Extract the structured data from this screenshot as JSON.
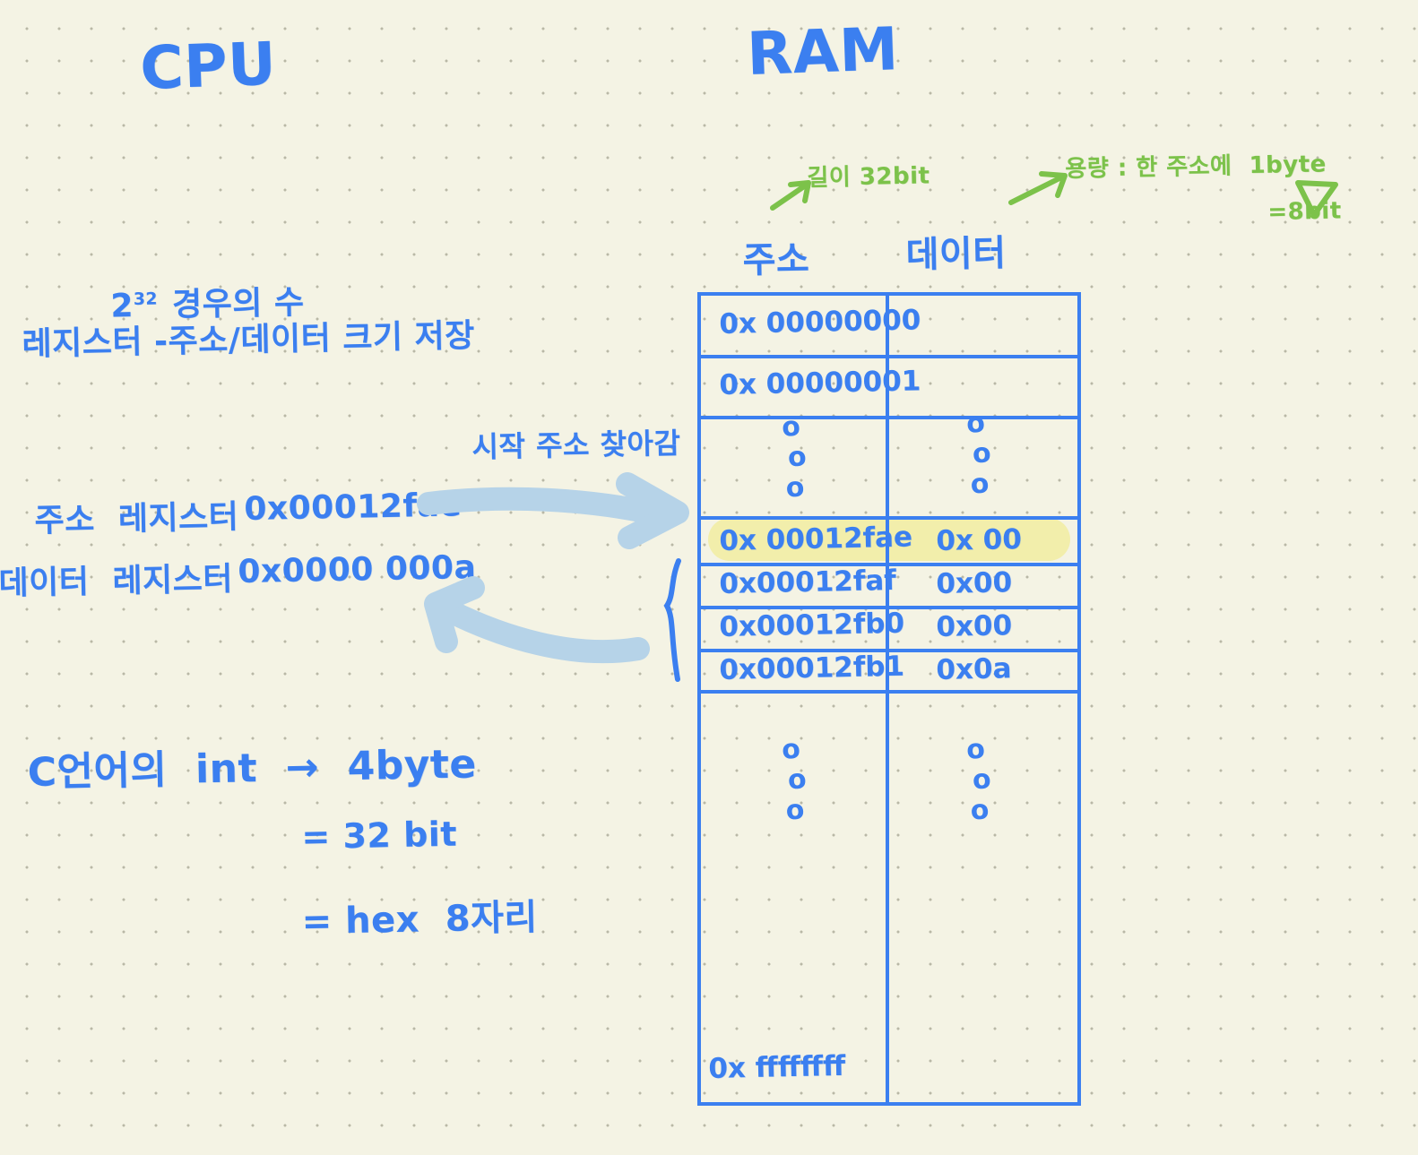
{
  "headings": {
    "cpu": "CPU",
    "ram": "RAM"
  },
  "cpu_notes": {
    "power_base": "2",
    "power_exp": "32",
    "power_label": "경우의 수",
    "register_note": "레지스터 -주소/데이터 크기 저장",
    "address_register_label": "주소  레지스터",
    "address_register_value": "0x00012fae",
    "data_register_label": "데이터  레지스터",
    "data_register_value": "0x0000 000a"
  },
  "c_notes": {
    "line1": "C언어의  int  →  4byte",
    "line2": "= 32 bit",
    "line3": "= hex  8자리"
  },
  "annotations": {
    "seek_start_address": "시작 주소 찾아감",
    "length_32bit": "길이 32bit",
    "capacity_line1": "용량 : 한 주소에  1byte",
    "capacity_line2": "=8bit"
  },
  "ram_table": {
    "col_headers": [
      "주소",
      "데이터"
    ],
    "rows": [
      {
        "address": "0x 00000000",
        "data": "",
        "type": "normal"
      },
      {
        "address": "0x 00000001",
        "data": "",
        "type": "normal"
      },
      {
        "address": "⋮",
        "data": "⋮",
        "type": "ellipsis"
      },
      {
        "address": "0x 00012fae",
        "data": "0x 00",
        "type": "highlight"
      },
      {
        "address": "0x00012faf",
        "data": "0x00",
        "type": "normal"
      },
      {
        "address": "0x00012fb0",
        "data": "0x00",
        "type": "normal"
      },
      {
        "address": "0x00012fb1",
        "data": "0x0a",
        "type": "normal"
      },
      {
        "address": "⋮",
        "data": "⋮",
        "type": "ellipsis"
      },
      {
        "address": "0x ffffffff",
        "data": "",
        "type": "normal"
      }
    ]
  },
  "colors": {
    "ink_blue": "#3b7ff0",
    "ink_green": "#7cc24a",
    "highlight_yellow": "#f2eeab",
    "arrow_blue": "#b6d3e8",
    "paper": "#f4f3e4"
  }
}
